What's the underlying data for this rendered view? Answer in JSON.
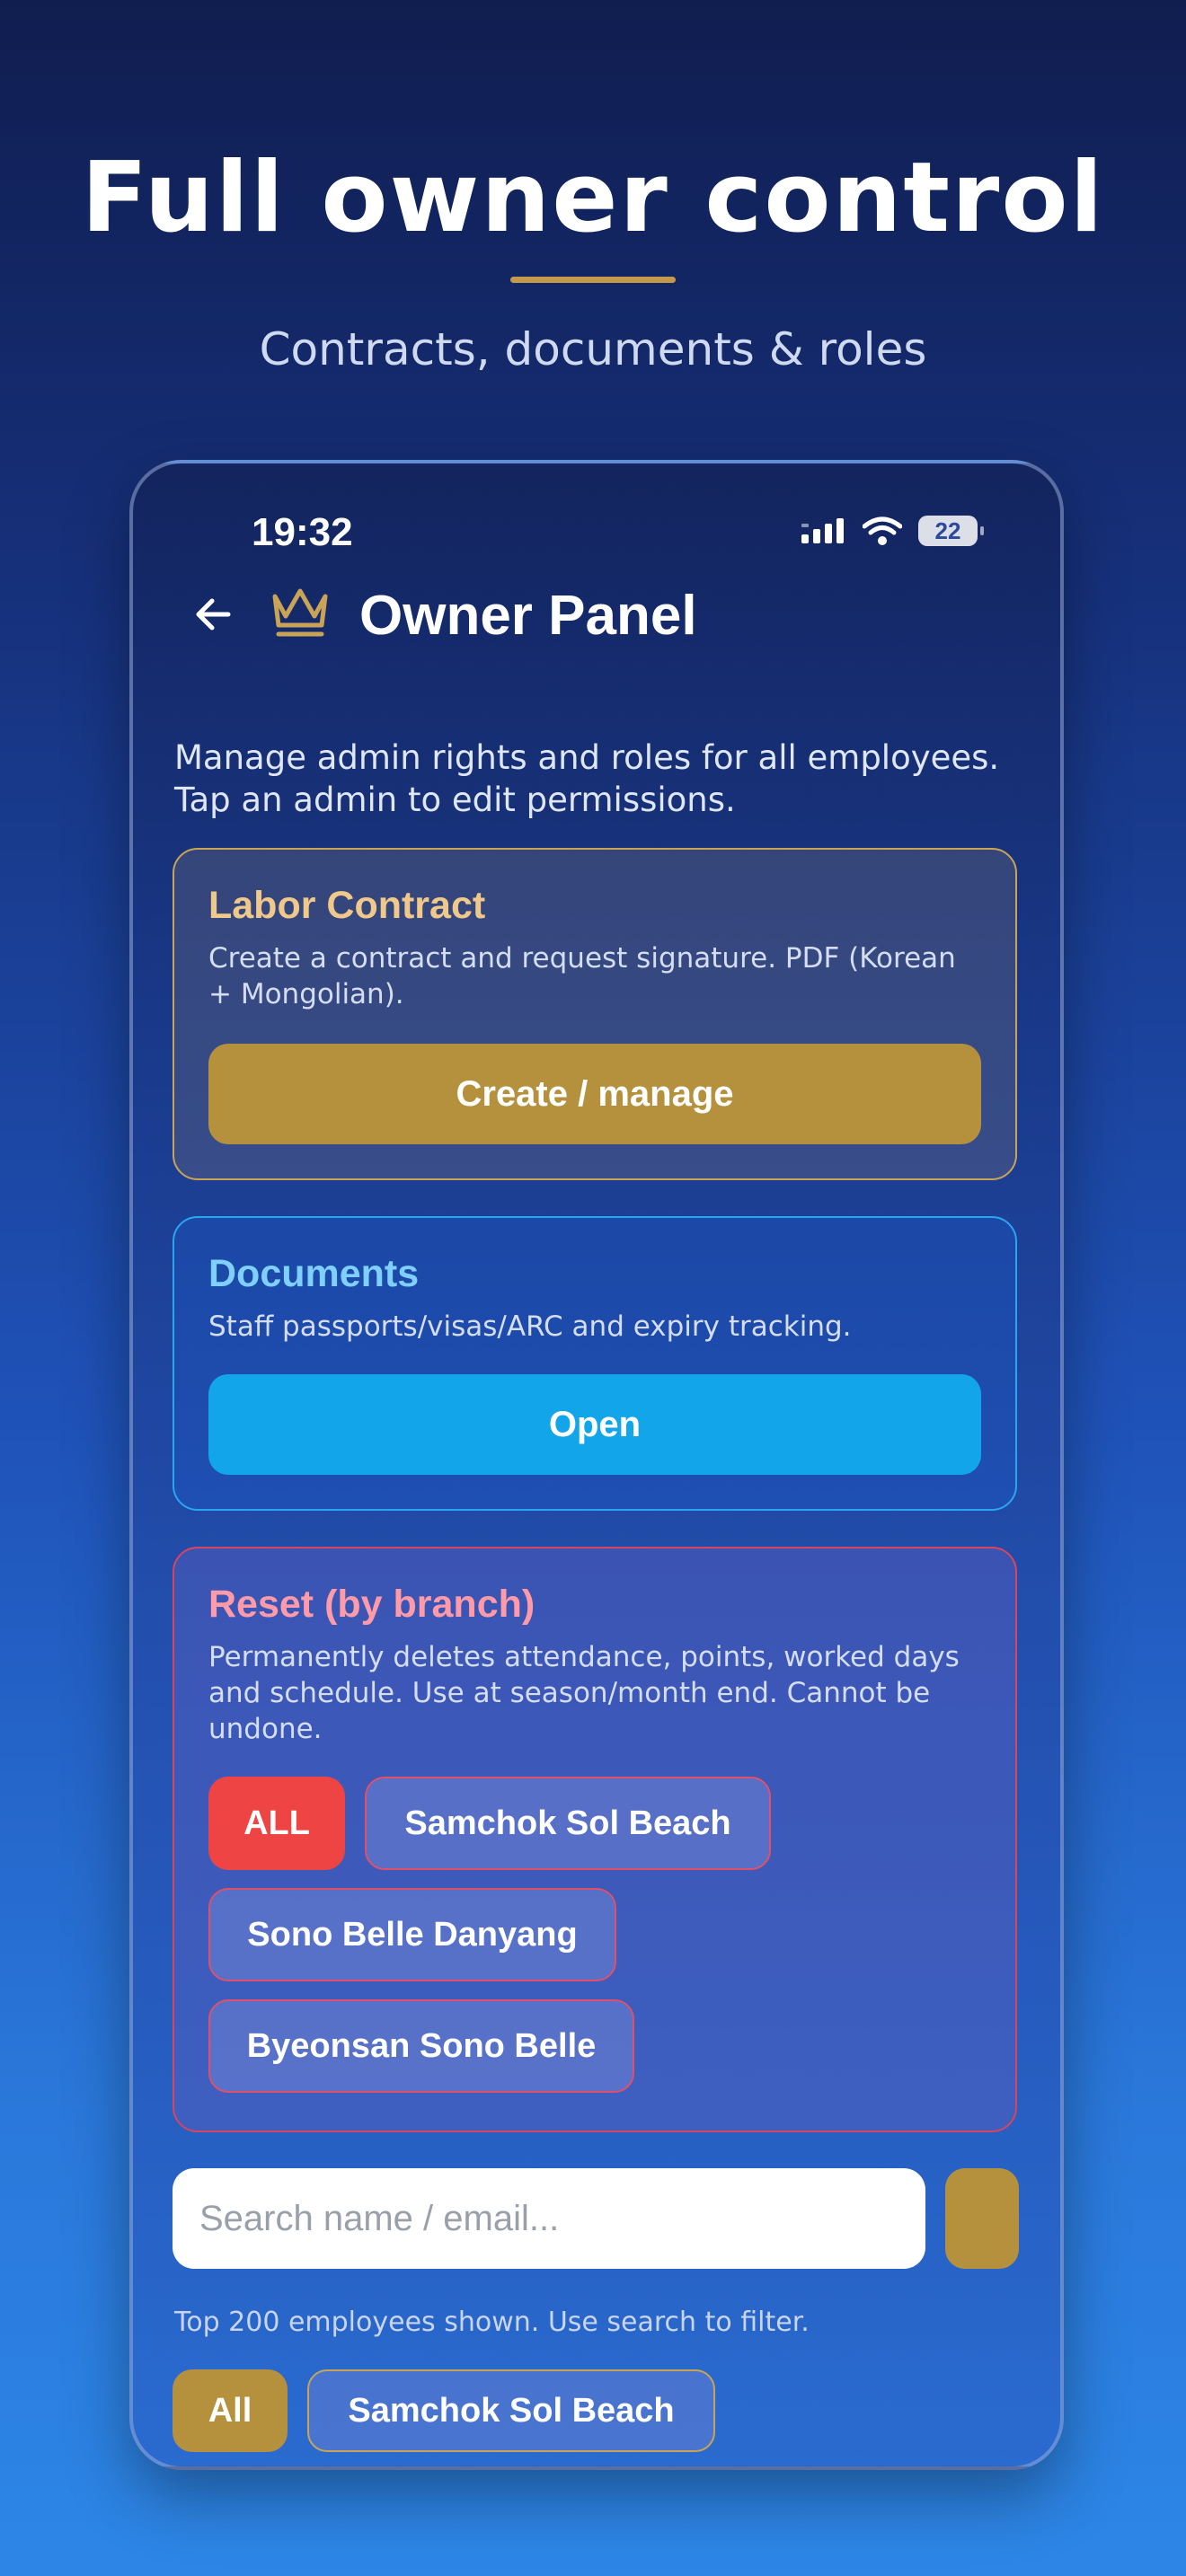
{
  "hero": {
    "title": "Full owner control",
    "subtitle": "Contracts, documents & roles",
    "accent_color": "#c39a4a"
  },
  "status_bar": {
    "time": "19:32",
    "battery": "22",
    "icons": [
      "signal-icon",
      "wifi-icon",
      "battery-icon"
    ]
  },
  "nav": {
    "back_icon": "arrow-left-icon",
    "title_icon": "crown-icon",
    "title": "Owner Panel"
  },
  "intro": "Manage admin rights and roles for all employees. Tap an admin to edit permissions.",
  "cards": {
    "contract": {
      "title": "Labor Contract",
      "description": "Create a contract and request signature. PDF (Korean + Mongolian).",
      "button": "Create / manage",
      "color": "#b5913e"
    },
    "documents": {
      "title": "Documents",
      "description": "Staff passports/visas/ARC and expiry tracking.",
      "button": "Open",
      "color": "#12a5ea"
    },
    "reset": {
      "title": "Reset (by branch)",
      "description": "Permanently deletes attendance, points, worked days and schedule. Use at season/month end. Cannot be undone.",
      "chips": [
        "ALL",
        "Samchok Sol Beach",
        "Sono Belle Danyang",
        "Byeonsan Sono Belle"
      ],
      "color": "#ef4444"
    }
  },
  "search": {
    "placeholder": "Search name / email...",
    "value": ""
  },
  "hint": "Top 200 employees shown. Use search to filter.",
  "filters": [
    "All",
    "Samchok Sol Beach"
  ]
}
